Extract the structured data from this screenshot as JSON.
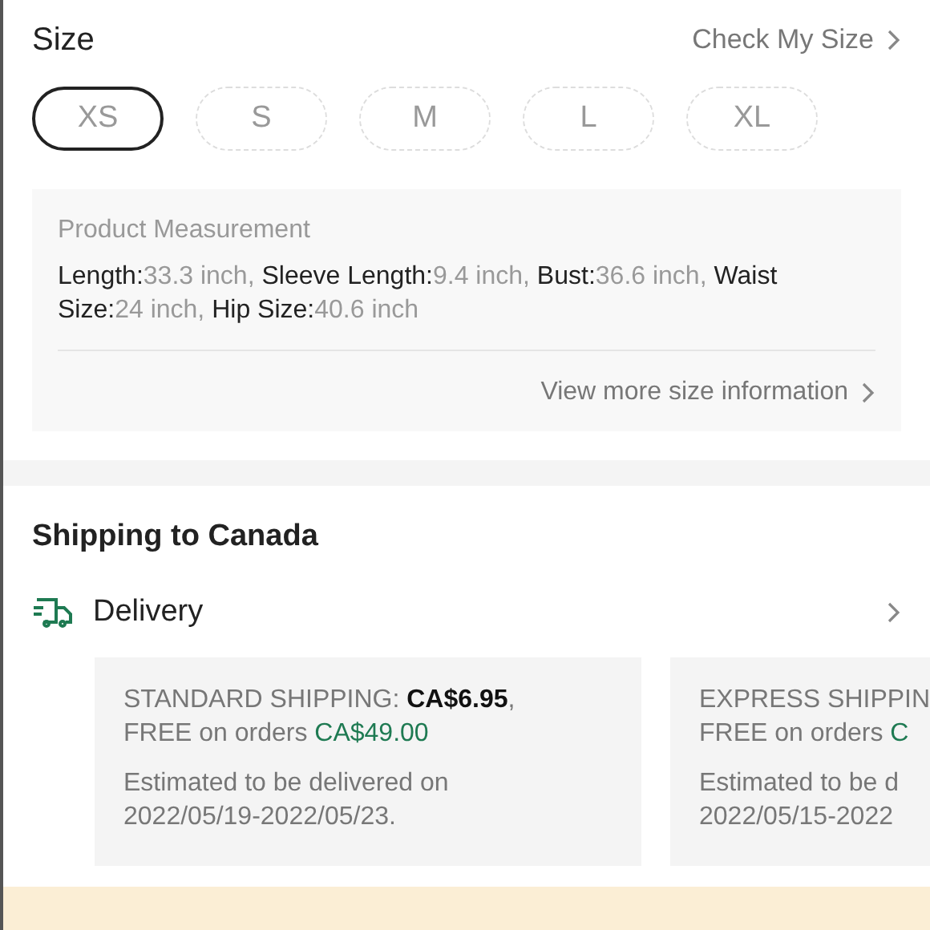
{
  "size": {
    "title": "Size",
    "check_link": "Check My Size",
    "options": [
      {
        "label": "XS",
        "selected": true
      },
      {
        "label": "S",
        "selected": false
      },
      {
        "label": "M",
        "selected": false
      },
      {
        "label": "L",
        "selected": false
      },
      {
        "label": "XL",
        "selected": false
      }
    ]
  },
  "measurement": {
    "title": "Product Measurement",
    "items": [
      {
        "label": "Length:",
        "value": "33.3 inch,"
      },
      {
        "label": "Sleeve Length:",
        "value": "9.4 inch,"
      },
      {
        "label": "Bust:",
        "value": "36.6 inch,"
      },
      {
        "label": "Waist Size:",
        "value": "24 inch,"
      },
      {
        "label": "Hip Size:",
        "value": "40.6 inch"
      }
    ],
    "more_link": "View more size information"
  },
  "shipping": {
    "title": "Shipping to Canada",
    "method": "Delivery",
    "options": [
      {
        "fee_label": "STANDARD SHIPPING: ",
        "fee": "CA$6.95",
        "fee_suffix": ",",
        "free_label": "FREE on orders ",
        "free_amount": "CA$49.00",
        "estimate": [
          "Estimated to be delivered on",
          "2022/05/19-2022/05/23."
        ]
      },
      {
        "fee_label": "EXPRESS SHIPPIN",
        "free_label": "FREE on orders ",
        "free_amount": "C",
        "estimate": [
          "Estimated to be d",
          "2022/05/15-2022"
        ]
      }
    ]
  }
}
